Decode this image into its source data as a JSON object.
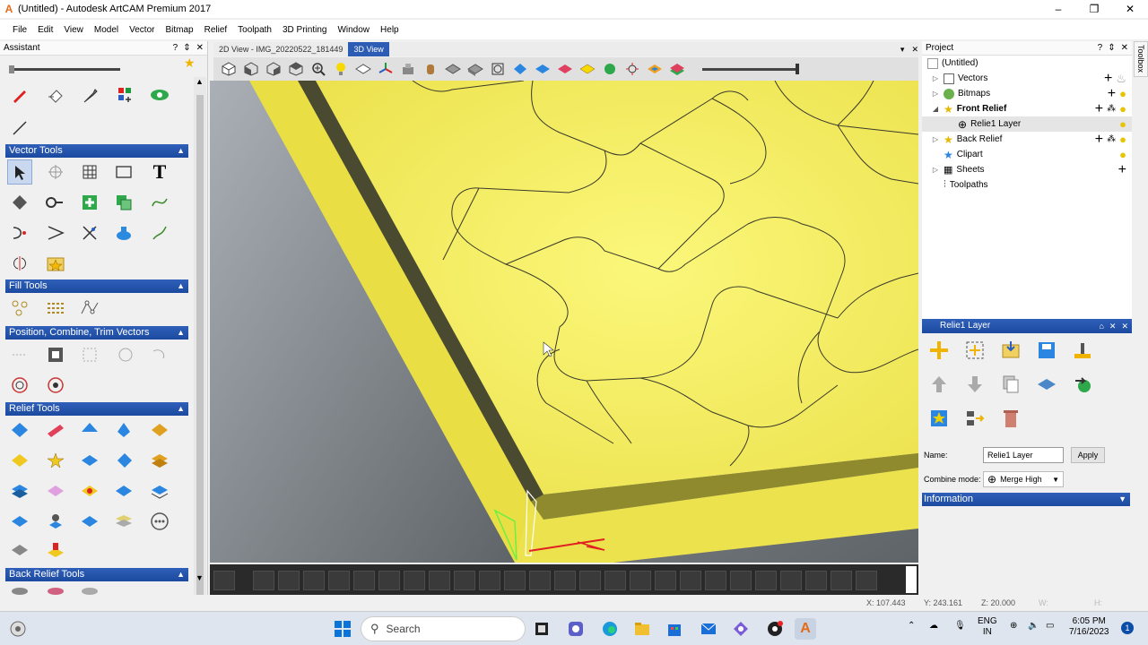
{
  "window": {
    "title": "(Untitled) - Autodesk ArtCAM Premium 2017",
    "minimize": "–",
    "maximize": "❐",
    "close": "✕"
  },
  "menu": [
    "File",
    "Edit",
    "View",
    "Model",
    "Vector",
    "Bitmap",
    "Relief",
    "Toolpath",
    "3D Printing",
    "Window",
    "Help"
  ],
  "assistant": {
    "title": "Assistant",
    "controls": [
      "?",
      "⇕",
      "✕"
    ],
    "sections": {
      "vector": "Vector Tools",
      "fill": "Fill Tools",
      "position": "Position, Combine, Trim Vectors",
      "relief": "Relief Tools",
      "back_relief": "Back Relief Tools"
    }
  },
  "views": {
    "tab_2d": "2D View - IMG_20220522_181449",
    "tab_3d": "3D View",
    "menu_btn": "▾",
    "close_btn": "✕"
  },
  "project": {
    "title": "Project",
    "controls": [
      "?",
      "⇕",
      "✕"
    ],
    "root": "(Untitled)",
    "items": [
      "Vectors",
      "Bitmaps",
      "Front Relief",
      "Relie1 Layer",
      "Back Relief",
      "Clipart",
      "Sheets",
      "Toolpaths"
    ],
    "toolbox": "Toolbox"
  },
  "layer": {
    "title": "Relie1 Layer",
    "name_label": "Name:",
    "name_value": "Relie1 Layer",
    "apply": "Apply",
    "combine_label": "Combine mode:",
    "combine_value": "Merge High",
    "information": "Information"
  },
  "status": {
    "x": "X: 107.443",
    "y": "Y: 243.161",
    "z": "Z: 20.000",
    "w": "W:",
    "h": "H:"
  },
  "taskbar": {
    "search": "Search",
    "lang1": "ENG",
    "lang2": "IN",
    "time": "6:05 PM",
    "date": "7/16/2023",
    "notif": "1"
  },
  "colors": {
    "accent": "#2d5cb5",
    "relief": "#f4ec66",
    "background3d": "#8b8f93"
  }
}
